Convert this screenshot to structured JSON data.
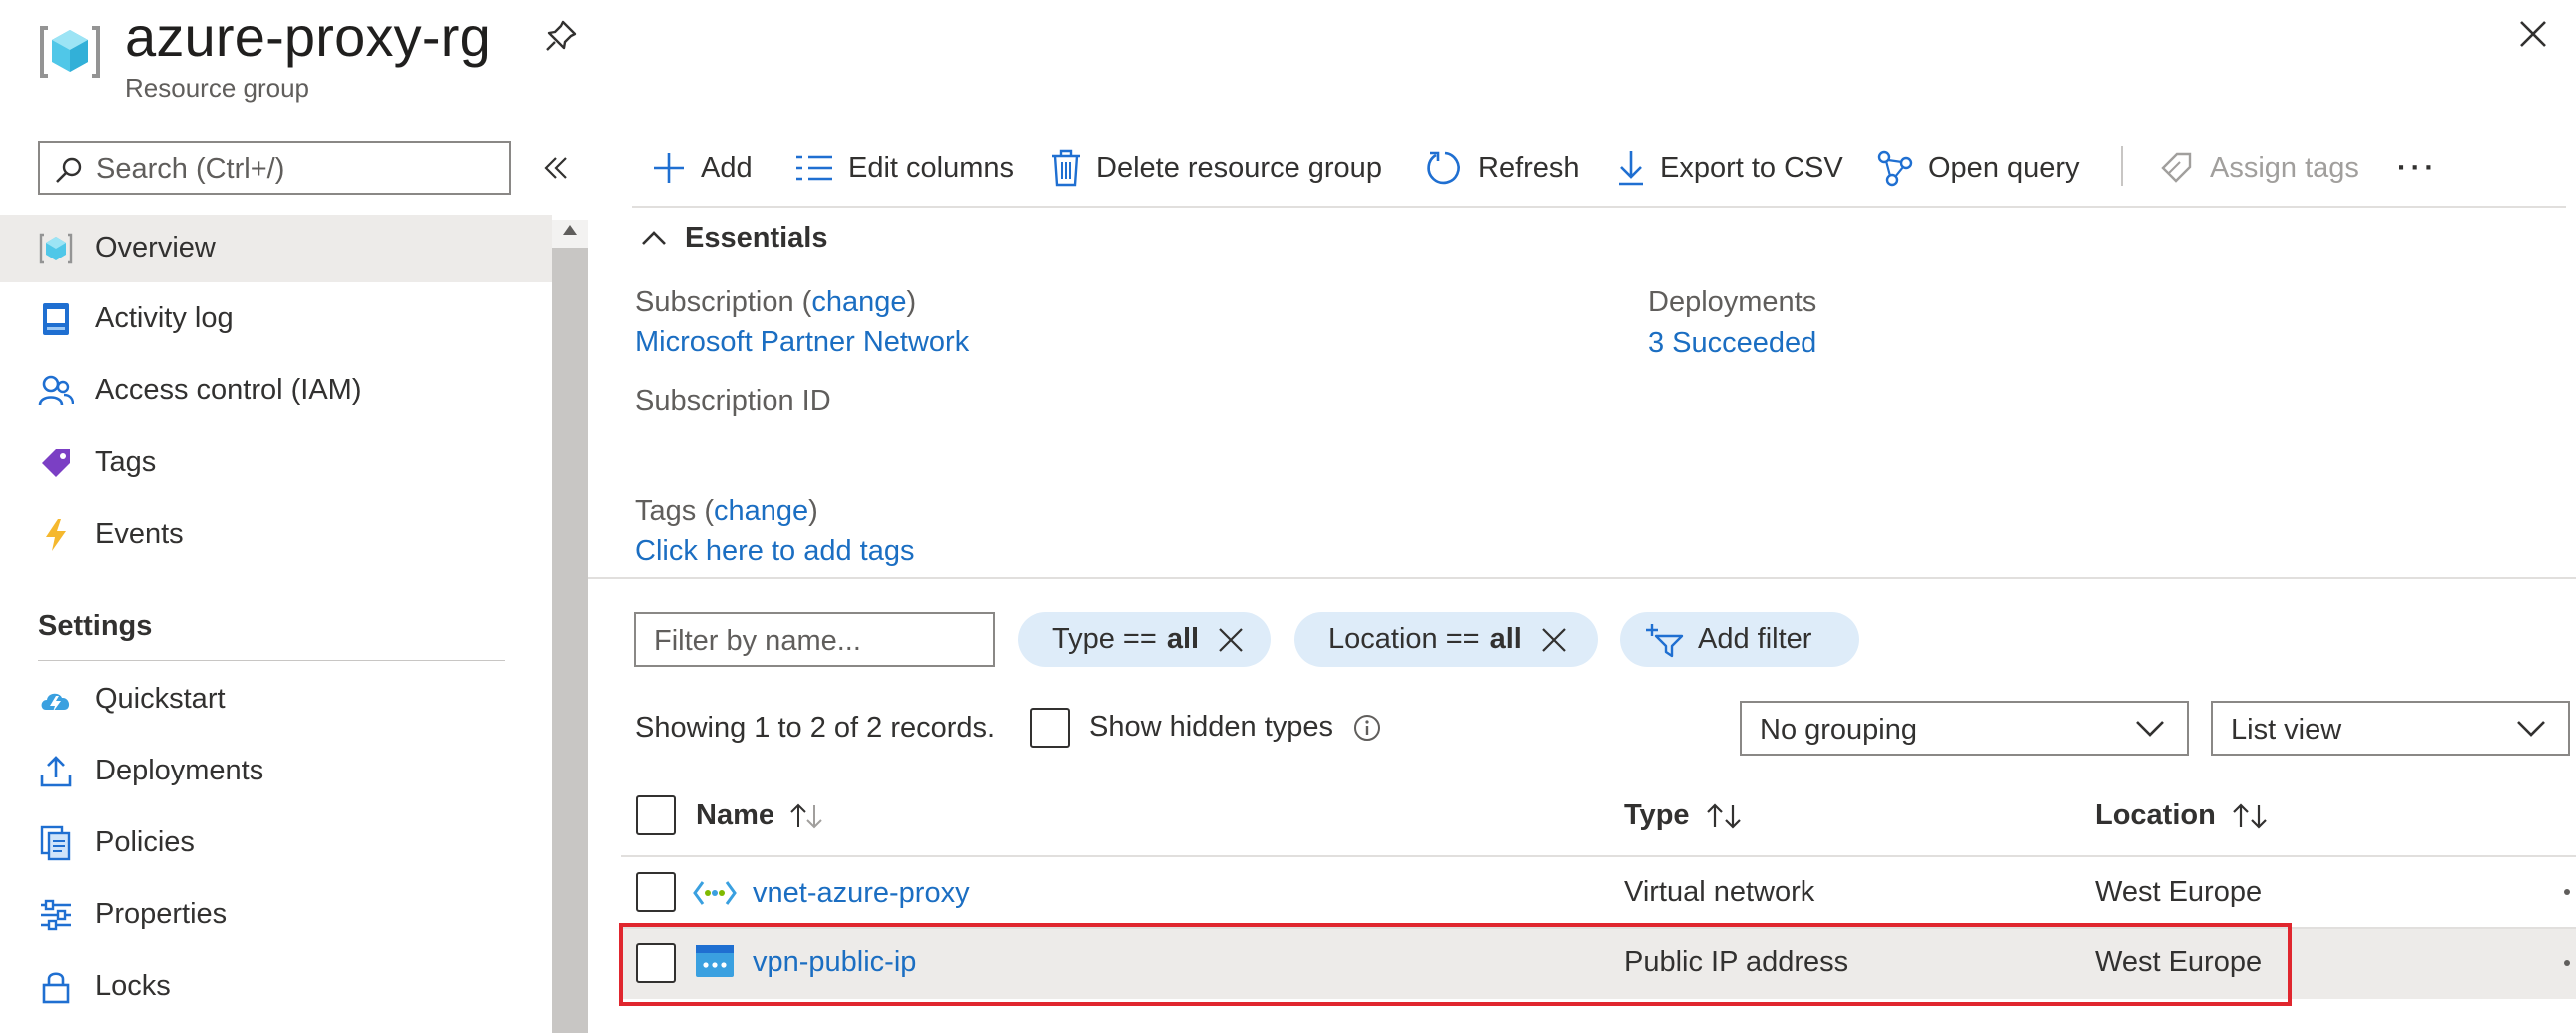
{
  "header": {
    "title": "azure-proxy-rg",
    "subtitle": "Resource group",
    "icons": [
      "resource-group-icon",
      "pin-icon",
      "close-icon"
    ]
  },
  "sidebar": {
    "search_placeholder": "Search (Ctrl+/)",
    "items": [
      {
        "label": "Overview",
        "icon": "overview-icon",
        "active": true
      },
      {
        "label": "Activity log",
        "icon": "activity-log-icon"
      },
      {
        "label": "Access control (IAM)",
        "icon": "iam-icon"
      },
      {
        "label": "Tags",
        "icon": "tag-icon"
      },
      {
        "label": "Events",
        "icon": "lightning-icon"
      }
    ],
    "settings_heading": "Settings",
    "settings_items": [
      {
        "label": "Quickstart",
        "icon": "quickstart-icon"
      },
      {
        "label": "Deployments",
        "icon": "upload-icon"
      },
      {
        "label": "Policies",
        "icon": "policy-icon"
      },
      {
        "label": "Properties",
        "icon": "properties-icon"
      },
      {
        "label": "Locks",
        "icon": "lock-icon"
      }
    ]
  },
  "toolbar": {
    "add": "Add",
    "edit_columns": "Edit columns",
    "delete": "Delete resource group",
    "refresh": "Refresh",
    "export": "Export to CSV",
    "open_query": "Open query",
    "assign_tags": "Assign tags",
    "more": "···"
  },
  "essentials": {
    "heading": "Essentials",
    "subscription_label": "Subscription (",
    "change": "change",
    "close_paren": ")",
    "subscription_value": "Microsoft Partner Network",
    "subscription_id_label": "Subscription ID",
    "deployments_label": "Deployments",
    "deployments_value": "3 Succeeded",
    "tags_label": "Tags (",
    "tags_link": "Click here to add tags"
  },
  "filters": {
    "name_placeholder": "Filter by name...",
    "type_pill_key": "Type ==",
    "type_pill_val": "all",
    "location_pill_key": "Location ==",
    "location_pill_val": "all",
    "add_filter": "Add filter"
  },
  "list": {
    "records_text": "Showing 1 to 2 of 2 records.",
    "show_hidden": "Show hidden types",
    "grouping": "No grouping",
    "view": "List view",
    "columns": [
      "Name",
      "Type",
      "Location"
    ],
    "rows": [
      {
        "name": "vnet-azure-proxy",
        "type": "Virtual network",
        "location": "West Europe",
        "icon": "virtual-network-icon"
      },
      {
        "name": "vpn-public-ip",
        "type": "Public IP address",
        "location": "West Europe",
        "icon": "public-ip-icon",
        "highlighted": true
      }
    ]
  },
  "colors": {
    "accent": "#1b6ec2",
    "highlight_border": "#e0262e",
    "pill_bg": "#deecf9"
  }
}
